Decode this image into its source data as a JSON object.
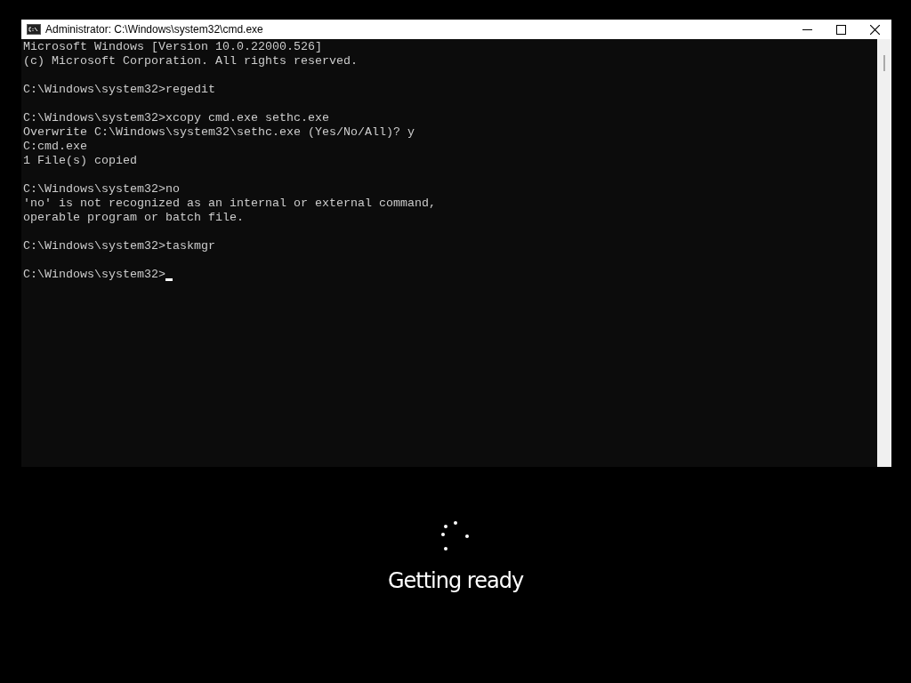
{
  "window": {
    "title": "Administrator: C:\\Windows\\system32\\cmd.exe"
  },
  "console": {
    "blocks": [
      [
        "Microsoft Windows [Version 10.0.22000.526]",
        "(c) Microsoft Corporation. All rights reserved."
      ],
      [
        "C:\\Windows\\system32>regedit"
      ],
      [
        "C:\\Windows\\system32>xcopy cmd.exe sethc.exe",
        "Overwrite C:\\Windows\\system32\\sethc.exe (Yes/No/All)? y",
        "C:cmd.exe",
        "1 File(s) copied"
      ],
      [
        "C:\\Windows\\system32>no",
        "'no' is not recognized as an internal or external command,",
        "operable program or batch file."
      ],
      [
        "C:\\Windows\\system32>taskmgr"
      ],
      [
        "C:\\Windows\\system32>"
      ]
    ],
    "cursor_visible": true
  },
  "status": {
    "message": "Getting ready"
  }
}
